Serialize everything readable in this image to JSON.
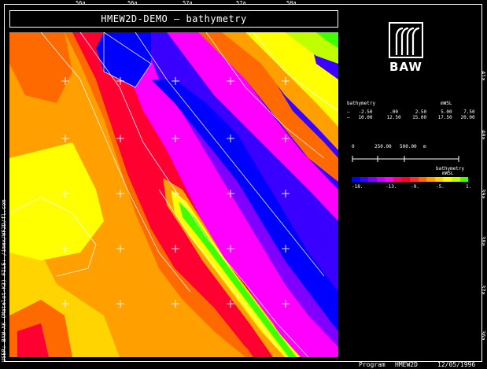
{
  "title": "HMEW2D-DEMO — bathymetry",
  "top_ticks": [
    "56a",
    "56a",
    "57a",
    "57a",
    "58a"
  ],
  "right_ticks": [
    "41a",
    "40a",
    "39a",
    "38a",
    "37a",
    "36a"
  ],
  "left_label": "USER: BAW-AK (Matelot-K3) FILE: /imex/WF2D/fl.com",
  "logo": {
    "text": "BAW"
  },
  "legend": {
    "label_bathymetry": "bathymetry",
    "label_mwsl": "mWSL",
    "row1": "—   -2.50      .00      2.50     5.00    7.50",
    "row2": "—   10.00     12.50    15.00    17.50   20.00"
  },
  "scale": {
    "label_0": "0",
    "label_250": "250.00",
    "label_500": "500.00",
    "unit": "m"
  },
  "colorbar": {
    "title": "bathymetry",
    "unit": "mWSL",
    "ticks": [
      "-18.",
      "-13.",
      "-9.",
      "-5.",
      "1."
    ],
    "colors": [
      "#0000ff",
      "#3a00ff",
      "#8000ff",
      "#c800ff",
      "#ff00ff",
      "#ff0080",
      "#ff0030",
      "#ff3030",
      "#ff6a00",
      "#ffa000",
      "#ffd400",
      "#ffff00",
      "#c0ff00",
      "#40ff00"
    ]
  },
  "footer": {
    "program_label": "Program",
    "program_name": "HMEW2D",
    "date": "12/05/1996"
  }
}
